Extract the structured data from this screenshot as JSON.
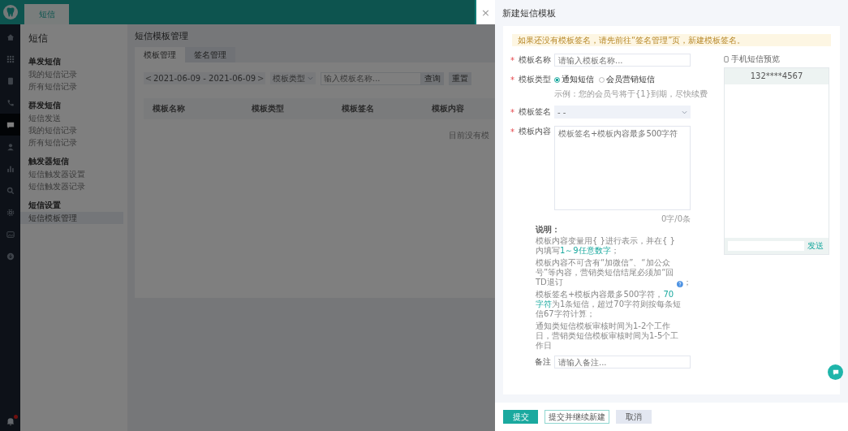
{
  "rail": {
    "items": [
      {
        "kind": "home",
        "selected": false
      },
      {
        "kind": "grid",
        "selected": false
      },
      {
        "kind": "document",
        "selected": false
      },
      {
        "kind": "phone",
        "selected": false
      },
      {
        "kind": "chat",
        "selected": true
      },
      {
        "kind": "user",
        "selected": false
      },
      {
        "kind": "chart",
        "selected": false
      },
      {
        "kind": "search",
        "selected": false
      },
      {
        "kind": "gear",
        "selected": false
      },
      {
        "kind": "image",
        "selected": false
      },
      {
        "kind": "download",
        "selected": false
      }
    ],
    "bell_badge": true
  },
  "top_tabs": [
    {
      "label": "短信",
      "selected": true
    }
  ],
  "sidebar": {
    "title": "短信",
    "groups": [
      {
        "heading": "单发短信",
        "items": [
          {
            "label": "我的短信记录",
            "selected": false
          },
          {
            "label": "所有短信记录",
            "selected": false
          }
        ]
      },
      {
        "heading": "群发短信",
        "items": [
          {
            "label": "短信发送",
            "selected": false
          },
          {
            "label": "我的短信记录",
            "selected": false
          },
          {
            "label": "所有短信记录",
            "selected": false
          }
        ]
      },
      {
        "heading": "触发器短信",
        "items": [
          {
            "label": "短信触发器设置",
            "selected": false
          },
          {
            "label": "短信触发器记录",
            "selected": false
          }
        ]
      },
      {
        "heading": "短信设置",
        "items": [
          {
            "label": "短信模板管理",
            "selected": true
          }
        ]
      }
    ]
  },
  "main": {
    "title": "短信模板管理",
    "tabs": [
      {
        "label": "模板管理",
        "selected": true
      },
      {
        "label": "签名管理",
        "selected": false
      }
    ],
    "filters": {
      "prev": "<",
      "date_range": "2021-06-09 - 2021-06-09",
      "next": ">",
      "type_select": "模板类型",
      "search_placeholder": "输入模板名称...",
      "buttons": [
        "查询",
        "重置"
      ]
    },
    "table": {
      "columns": [
        "模板名称",
        "模板类型",
        "模板签名",
        "模板内容"
      ],
      "empty": "目前没有模"
    }
  },
  "drawer": {
    "close": "×",
    "title": "新建短信模板",
    "alert": "如果还没有模板签名，请先前往“签名管理”页，新建模板签名。",
    "name_field": {
      "label": "模板名称",
      "required_mark": "*",
      "placeholder": "请输入模板名称..."
    },
    "type_field": {
      "label": "模板类型",
      "required_mark": "*",
      "options": [
        {
          "label": "通知短信",
          "selected": true
        },
        {
          "label": "会员营销短信",
          "selected": false
        }
      ],
      "hint": "示例：您的会员号将于{1}到期，尽快续费"
    },
    "signature_field": {
      "label": "模板签名",
      "required_mark": "*",
      "value": "- -"
    },
    "content_field": {
      "label": "模板内容",
      "required_mark": "*",
      "placeholder": "模板签名+模板内容最多500字符",
      "counter": "0字/0条"
    },
    "notes": {
      "title": "说明：",
      "items": [
        {
          "text": "模板内容变量用{ }进行表示，并在{ }内填写**1～9任意数字**；",
          "help": false
        },
        {
          "text": "模板内容不可含有“加微信”、“加公众号”等内容，营销类短信结尾必须加“回TD退订",
          "help": true,
          "tail": "；"
        },
        {
          "text": "模板签名+模板内容最多500字符，**70字符**为1条短信，超过70字符则按每条短信67字符计算；",
          "help": false
        },
        {
          "text": "通知类短信模板审核时间为1-2个工作日，营销类短信模板审核时间为1-5个工作日",
          "help": false
        }
      ]
    },
    "remark_field": {
      "label": "备注",
      "placeholder": "请输入备注..."
    },
    "preview": {
      "title": "手机短信预览",
      "phone": "132****4567",
      "send": "发送"
    },
    "footer": {
      "submit": "提交",
      "submit_continue": "提交并继续新建",
      "cancel": "取消"
    }
  }
}
